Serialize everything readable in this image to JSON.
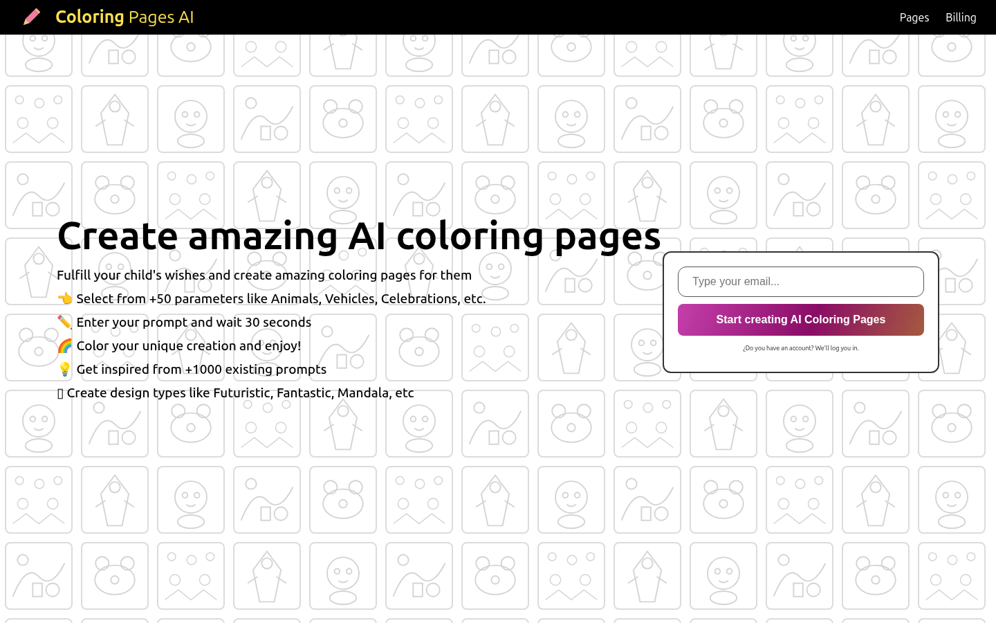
{
  "header": {
    "logo": "**Coloring** Pages AI",
    "nav": [
      {
        "label": "Pages"
      },
      {
        "label": "Billing"
      }
    ]
  },
  "hero": {
    "title": "Create amazing AI coloring pages",
    "lines": [
      "Fulfill your child's wishes and create amazing coloring pages for them",
      "👈 Select from +50 parameters like Animals, Vehicles, Celebrations, etc.",
      "✏️ Enter your prompt and wait 30 seconds",
      "🌈 Color your unique creation and enjoy!",
      "💡 Get inspired from +1000 existing prompts",
      "▯ Create design types like Futuristic, Fantastic, Mandala, etc"
    ]
  },
  "signup": {
    "email": {
      "placeholder": "Type your email..."
    },
    "button": "Start creating AI Coloring Pages",
    "note": "¿Do you have an account? We'll log you in."
  }
}
